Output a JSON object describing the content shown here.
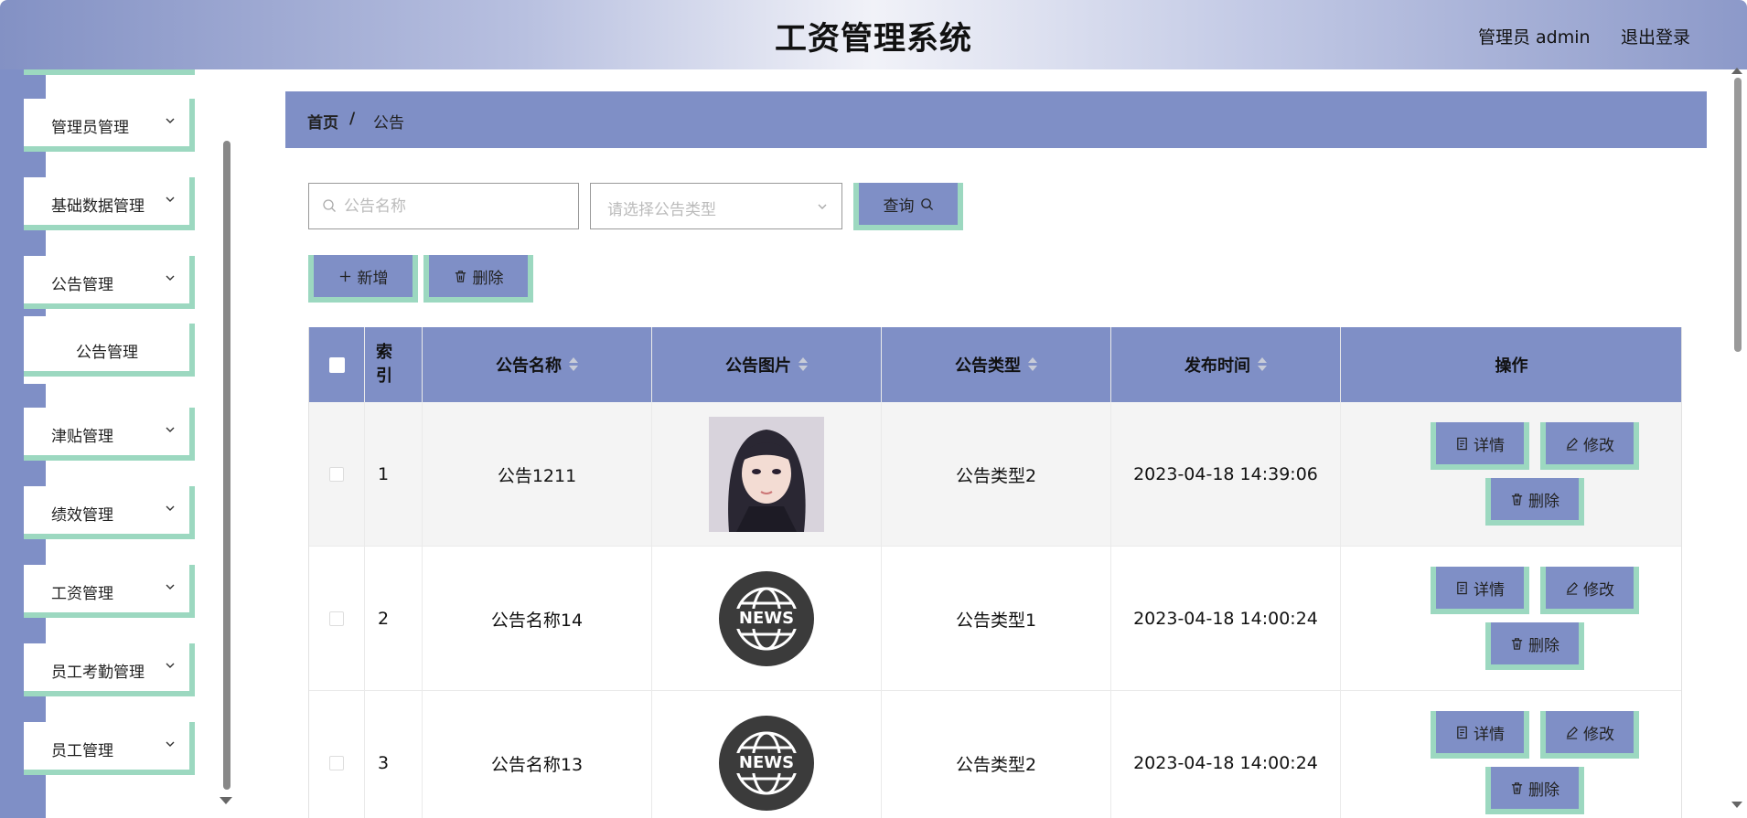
{
  "app": {
    "title": "工资管理系统",
    "user": "管理员 admin",
    "logout": "退出登录"
  },
  "sidebar": {
    "items": [
      {
        "label": "管理员管理"
      },
      {
        "label": "基础数据管理"
      },
      {
        "label": "公告管理"
      },
      {
        "label": "津贴管理"
      },
      {
        "label": "绩效管理"
      },
      {
        "label": "工资管理"
      },
      {
        "label": "员工考勤管理"
      },
      {
        "label": "员工管理"
      }
    ],
    "submenu": {
      "label": "公告管理"
    }
  },
  "breadcrumb": {
    "home": "首页",
    "separator": "/",
    "current": "公告"
  },
  "search": {
    "name_placeholder": "公告名称",
    "type_placeholder": "请选择公告类型",
    "query_label": "查询"
  },
  "toolbar": {
    "add_label": "新增",
    "delete_label": "删除"
  },
  "table": {
    "headers": {
      "index": "索引",
      "name": "公告名称",
      "image": "公告图片",
      "type": "公告类型",
      "time": "发布时间",
      "ops": "操作"
    },
    "rows": [
      {
        "index": "1",
        "name": "公告1211",
        "image": "portrait-photo",
        "type": "公告类型2",
        "time": "2023-04-18 14:39:06"
      },
      {
        "index": "2",
        "name": "公告名称14",
        "image": "news-icon",
        "news_text": "NEWS",
        "type": "公告类型1",
        "time": "2023-04-18 14:00:24"
      },
      {
        "index": "3",
        "name": "公告名称13",
        "image": "news-icon",
        "news_text": "NEWS",
        "type": "公告类型2",
        "time": "2023-04-18 14:00:24"
      }
    ],
    "actions": {
      "detail": "详情",
      "edit": "修改",
      "delete": "删除"
    }
  },
  "colors": {
    "accent": "#7f8fc6",
    "border_accent": "#9cd8c0"
  }
}
